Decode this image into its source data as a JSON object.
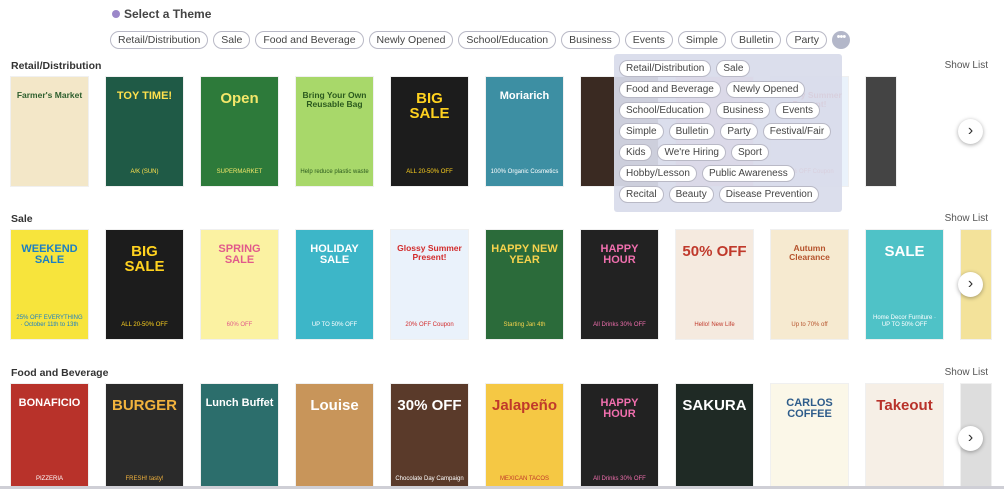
{
  "header": {
    "title": "Select a Theme"
  },
  "theme_pills": [
    "Retail/Distribution",
    "Sale",
    "Food and Beverage",
    "Newly Opened",
    "School/Education",
    "Business",
    "Events",
    "Simple",
    "Bulletin",
    "Party"
  ],
  "more_label": "•••",
  "dropdown": [
    "Retail/Distribution",
    "Sale",
    "Food and Beverage",
    "Newly Opened",
    "School/Education",
    "Business",
    "Events",
    "Simple",
    "Bulletin",
    "Party",
    "Festival/Fair",
    "Kids",
    "We're Hiring",
    "Sport",
    "Hobby/Lesson",
    "Public Awareness",
    "Recital",
    "Beauty",
    "Disease Prevention"
  ],
  "show_list_label": "Show List",
  "next_label": "›",
  "sections": [
    {
      "title": "Retail/Distribution",
      "cards": [
        {
          "title": "Farmer's Market",
          "sub": "",
          "bg": "#f3e7c8",
          "fg": "#2e5f2e"
        },
        {
          "title": "TOY TIME!",
          "sub": "A/K (SUN)",
          "bg": "#1f5a46",
          "fg": "#ffe14d"
        },
        {
          "title": "Open",
          "sub": "SUPERMARKET",
          "bg": "#2d7a3a",
          "fg": "#f4e76a"
        },
        {
          "title": "Bring Your Own Reusable Bag",
          "sub": "Help reduce plastic waste",
          "bg": "#a8d86a",
          "fg": "#2b5a1e"
        },
        {
          "title": "BIG SALE",
          "sub": "ALL 20-50% OFF",
          "bg": "#1c1c1c",
          "fg": "#ffd21f"
        },
        {
          "title": "Moriarich",
          "sub": "100% Organic Cosmetics",
          "bg": "#3d8fa3",
          "fg": "#ffffff"
        },
        {
          "title": "",
          "sub": "",
          "bg": "#3a2a22",
          "fg": "#ffffff"
        },
        {
          "title": "",
          "sub": "",
          "bg": "#f6b9c9",
          "fg": "#ffffff"
        },
        {
          "title": "Glossy Summer Present!",
          "sub": "20% OFF Coupon",
          "bg": "#eaf2fb",
          "fg": "#d22b2b"
        },
        {
          "title": "",
          "sub": "",
          "bg": "#444",
          "fg": "#fff"
        }
      ]
    },
    {
      "title": "Sale",
      "cards": [
        {
          "title": "WEEKEND SALE",
          "sub": "25% OFF EVERYTHING · October 11th to 13th",
          "bg": "#f7e43c",
          "fg": "#1b7fc4"
        },
        {
          "title": "BIG SALE",
          "sub": "ALL 20-50% OFF",
          "bg": "#1c1c1c",
          "fg": "#ffd21f"
        },
        {
          "title": "SPRING SALE",
          "sub": "60% OFF",
          "bg": "#fbf2a2",
          "fg": "#e15a8b"
        },
        {
          "title": "HOLIDAY SALE",
          "sub": "UP TO 50% OFF",
          "bg": "#3db6c8",
          "fg": "#ffffff"
        },
        {
          "title": "Glossy Summer Present!",
          "sub": "20% OFF Coupon",
          "bg": "#eaf2fb",
          "fg": "#d22b2b"
        },
        {
          "title": "HAPPY NEW YEAR",
          "sub": "Starting Jan 4th",
          "bg": "#2b6b3a",
          "fg": "#f7d34d"
        },
        {
          "title": "HAPPY HOUR",
          "sub": "All Drinks 30% OFF",
          "bg": "#222",
          "fg": "#f06fae"
        },
        {
          "title": "50% OFF",
          "sub": "Hello! New Life",
          "bg": "#f5eadf",
          "fg": "#c0392b"
        },
        {
          "title": "Autumn Clearance",
          "sub": "Up to 70% off",
          "bg": "#f6ead0",
          "fg": "#b5522b"
        },
        {
          "title": "SALE",
          "sub": "Home Decor Furniture · UP TO 50% OFF",
          "bg": "#4fc2c7",
          "fg": "#ffffff"
        },
        {
          "title": "",
          "sub": "",
          "bg": "#f3e29a",
          "fg": "#fff"
        }
      ]
    },
    {
      "title": "Food and Beverage",
      "cards": [
        {
          "title": "BONAFICIO",
          "sub": "PIZZERIA",
          "bg": "#b8322a",
          "fg": "#ffffff"
        },
        {
          "title": "BURGER",
          "sub": "FRESH! tasty!",
          "bg": "#2a2a2a",
          "fg": "#f2b33d"
        },
        {
          "title": "Lunch Buffet",
          "sub": "",
          "bg": "#2c6e6c",
          "fg": "#ffffff"
        },
        {
          "title": "Louise",
          "sub": "",
          "bg": "#c8955a",
          "fg": "#ffffff"
        },
        {
          "title": "30% OFF",
          "sub": "Chocolate Day Campaign",
          "bg": "#5a3a2a",
          "fg": "#ffffff"
        },
        {
          "title": "Jalapeño",
          "sub": "MEXICAN TACOS",
          "bg": "#f5c844",
          "fg": "#c0392b"
        },
        {
          "title": "HAPPY HOUR",
          "sub": "All Drinks 30% OFF",
          "bg": "#222",
          "fg": "#f06fae"
        },
        {
          "title": "SAKURA",
          "sub": "",
          "bg": "#1f2a25",
          "fg": "#ffffff"
        },
        {
          "title": "CARLOS COFFEE",
          "sub": "",
          "bg": "#fbf7e8",
          "fg": "#2e5c8a"
        },
        {
          "title": "Takeout",
          "sub": "",
          "bg": "#f6efe6",
          "fg": "#b8322a"
        },
        {
          "title": "",
          "sub": "",
          "bg": "#ddd",
          "fg": "#fff"
        }
      ]
    }
  ]
}
